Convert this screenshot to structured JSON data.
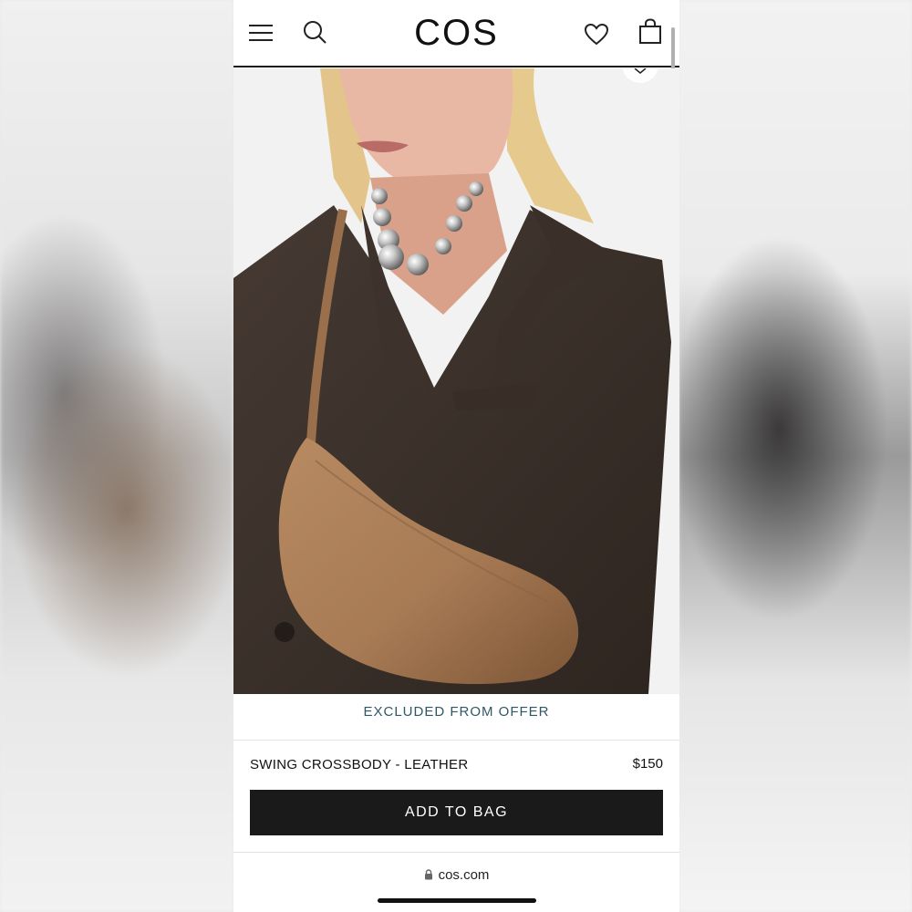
{
  "header": {
    "logo": "COS",
    "icons": [
      "menu-icon",
      "search-icon",
      "heart-icon",
      "shopping-bag-icon"
    ]
  },
  "hero": {
    "alt": "Model wearing a brown blazer, silver bead necklace and tan leather crossbody bag",
    "colors": {
      "blazer": "#3b302a",
      "bag": "#a87b55",
      "hair": "#e6c98c",
      "background": "#f1f2f1"
    }
  },
  "offer": {
    "label": "EXCLUDED FROM OFFER",
    "color": "#2f5867"
  },
  "product": {
    "name": "SWING CROSSBODY - LEATHER",
    "price": "$150"
  },
  "cta": {
    "label": "ADD TO BAG"
  },
  "browser": {
    "url": "cos.com",
    "icon": "lock-icon"
  }
}
